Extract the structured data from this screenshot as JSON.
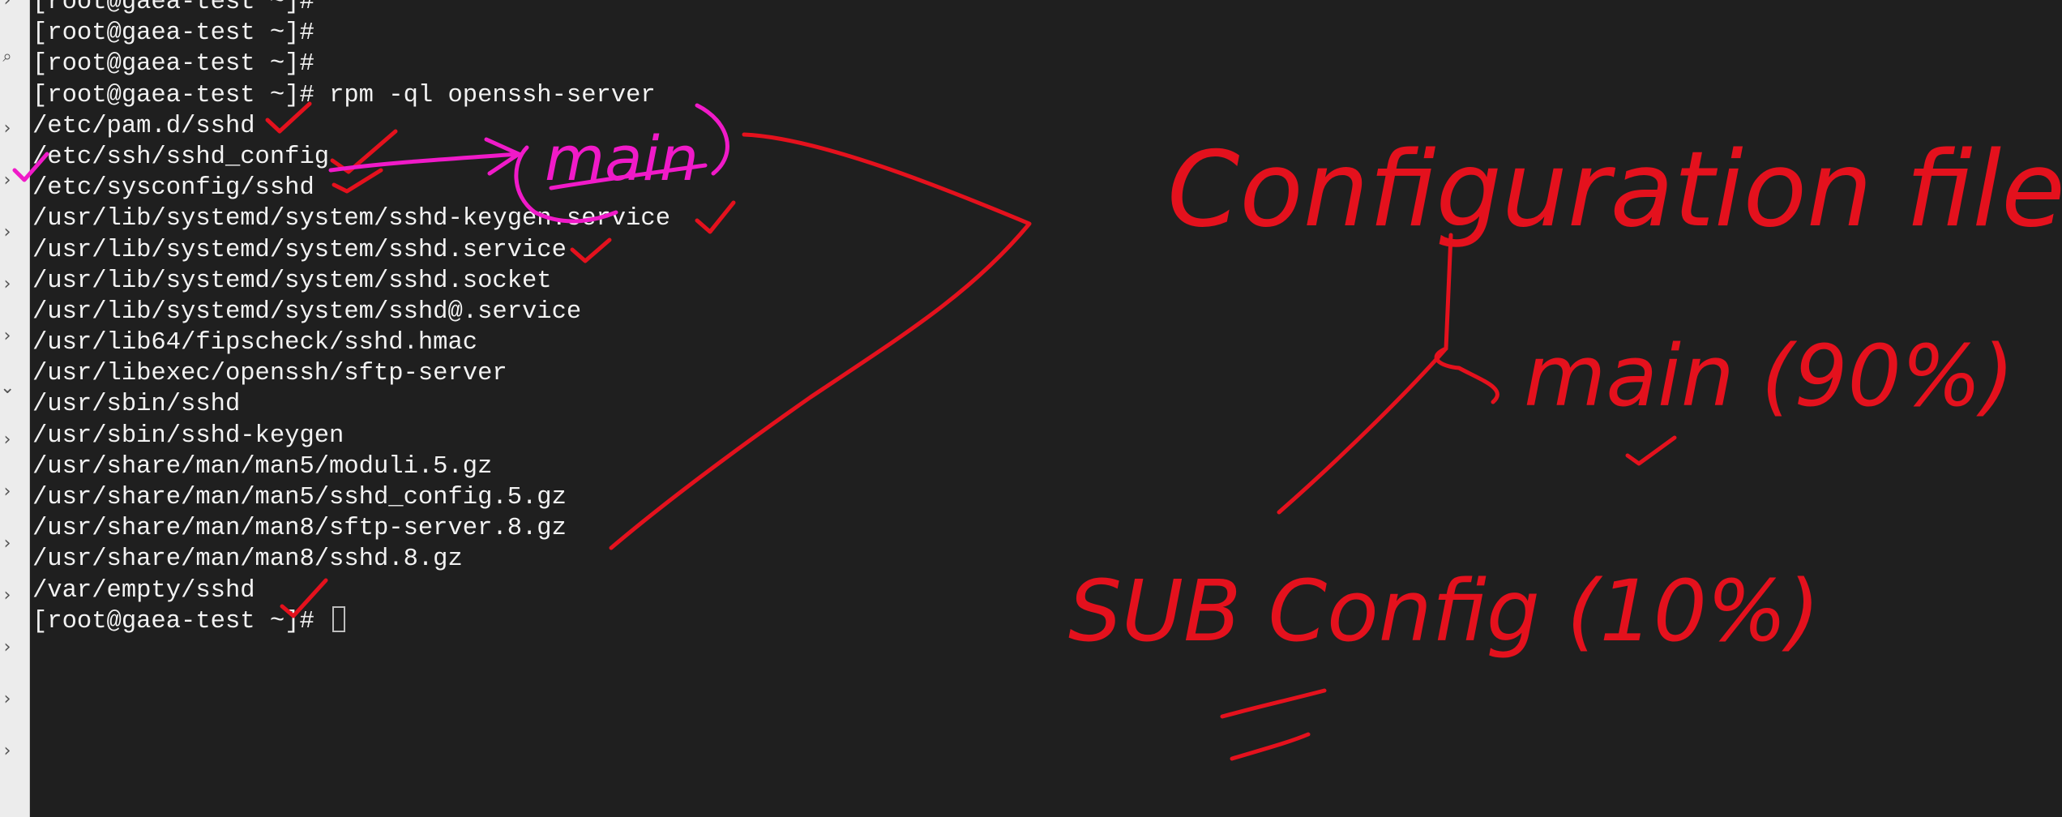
{
  "terminal": {
    "prompt": "[root@gaea-test ~]#",
    "lines": [
      {
        "prompt": "[root@gaea-test ~]#",
        "text": ""
      },
      {
        "prompt": "[root@gaea-test ~]#",
        "text": ""
      },
      {
        "prompt": "[root@gaea-test ~]#",
        "text": ""
      },
      {
        "prompt": "[root@gaea-test ~]#",
        "text": " rpm -ql openssh-server"
      },
      {
        "prompt": "",
        "text": "/etc/pam.d/sshd"
      },
      {
        "prompt": "",
        "text": "/etc/ssh/sshd_config"
      },
      {
        "prompt": "",
        "text": "/etc/sysconfig/sshd"
      },
      {
        "prompt": "",
        "text": "/usr/lib/systemd/system/sshd-keygen.service"
      },
      {
        "prompt": "",
        "text": "/usr/lib/systemd/system/sshd.service"
      },
      {
        "prompt": "",
        "text": "/usr/lib/systemd/system/sshd.socket"
      },
      {
        "prompt": "",
        "text": "/usr/lib/systemd/system/sshd@.service"
      },
      {
        "prompt": "",
        "text": "/usr/lib64/fipscheck/sshd.hmac"
      },
      {
        "prompt": "",
        "text": "/usr/libexec/openssh/sftp-server"
      },
      {
        "prompt": "",
        "text": "/usr/sbin/sshd"
      },
      {
        "prompt": "",
        "text": "/usr/sbin/sshd-keygen"
      },
      {
        "prompt": "",
        "text": "/usr/share/man/man5/moduli.5.gz"
      },
      {
        "prompt": "",
        "text": "/usr/share/man/man5/sshd_config.5.gz"
      },
      {
        "prompt": "",
        "text": "/usr/share/man/man8/sftp-server.8.gz"
      },
      {
        "prompt": "",
        "text": "/usr/share/man/man8/sshd.8.gz"
      },
      {
        "prompt": "",
        "text": "/var/empty/sshd"
      },
      {
        "prompt": "[root@gaea-test ~]#",
        "text": " "
      }
    ]
  },
  "annotations": {
    "main_label": "main",
    "heading": "Configuration files",
    "branch_main": "main (90%)",
    "branch_sub": "SUB Config (10%)"
  },
  "colors": {
    "background": "#1f1f1f",
    "text": "#f2f2f2",
    "ink_red": "#e4111d",
    "ink_magenta": "#f01ac8",
    "gutter": "#ececec"
  },
  "gutter": {
    "icons": [
      "chevron-right-icon",
      "search-icon"
    ]
  }
}
